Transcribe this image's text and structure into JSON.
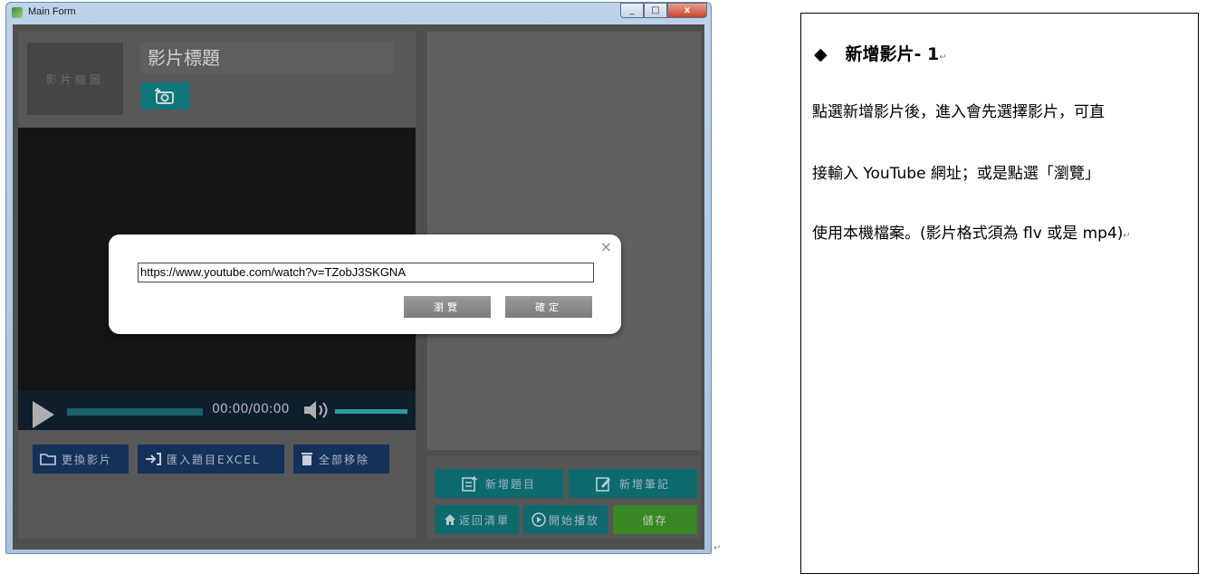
{
  "window": {
    "title": "Main Form",
    "close_glyph": "x",
    "max_glyph": "□",
    "min_glyph": "_"
  },
  "video": {
    "thumbnail_label": "影片縮圖",
    "title": "影片標題",
    "time": "00:00/00:00",
    "progress": 0,
    "volume": 1.0
  },
  "left_actions": {
    "change_video": "更換影片",
    "import_excel": "匯入題目EXCEL",
    "remove_all": "全部移除"
  },
  "right_actions": {
    "add_question": "新增題目",
    "add_note": "新增筆記",
    "back_to_list": "返回清單",
    "start_play": "開始播放",
    "save": "儲存"
  },
  "dialog": {
    "url_value": "https://www.youtube.com/watch?v=TZobJ3SKGNA",
    "browse_label": "瀏覽",
    "confirm_label": "確定",
    "close_glyph": "×"
  },
  "doc": {
    "bullet": "◆",
    "heading": "新增影片- 1",
    "lines": [
      "點選新增影片後，進入會先選擇影片，可直",
      "接輸入 YouTube 網址；或是點選「瀏覽」",
      "使用本機檔案。(影片格式須為 flv 或是 mp4)"
    ],
    "paragraph_mark": "↵"
  },
  "colors": {
    "teal": "#0f7a7e",
    "green": "#3f9a28",
    "navy": "#173a66"
  }
}
